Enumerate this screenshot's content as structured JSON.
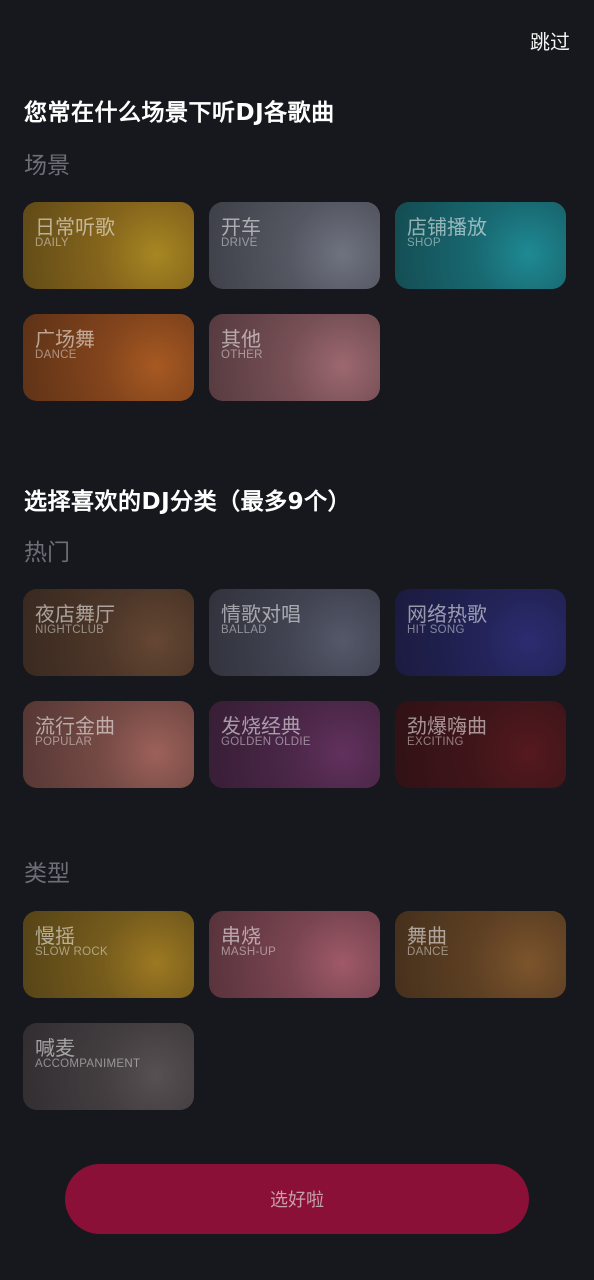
{
  "header": {
    "skip_label": "跳过"
  },
  "scene_section": {
    "title": "您常在什么场景下听DJ各歌曲",
    "group_label": "场景",
    "items": [
      {
        "name": "日常听歌",
        "en": "DAILY",
        "icon": "headphones-woman-photo",
        "color": "#c9961c"
      },
      {
        "name": "开车",
        "en": "DRIVE",
        "icon": "car-photo",
        "color": "#7a7f8c"
      },
      {
        "name": "店铺播放",
        "en": "SHOP",
        "icon": "building-photo",
        "color": "#1a9aa4"
      },
      {
        "name": "广场舞",
        "en": "DANCE",
        "icon": "cassette-photo",
        "color": "#c4601c"
      },
      {
        "name": "其他",
        "en": "OTHER",
        "icon": "pink-headphones-photo",
        "color": "#b07278"
      }
    ]
  },
  "category_section": {
    "title": "选择喜欢的DJ分类（最多9个）",
    "hot_label": "热门",
    "hot_items": [
      {
        "name": "夜店舞厅",
        "en": "NIGHTCLUB",
        "icon": "nightclub-silhouette-photo",
        "color": "#6e4a30"
      },
      {
        "name": "情歌对唱",
        "en": "BALLAD",
        "icon": "couple-sunset-photo",
        "color": "#5b5f72"
      },
      {
        "name": "网络热歌",
        "en": "HIT SONG",
        "icon": "neon-light-photo",
        "color": "#2a2a7a"
      },
      {
        "name": "流行金曲",
        "en": "POPULAR",
        "icon": "woman-headphones-photo",
        "color": "#b06a5e"
      },
      {
        "name": "发烧经典",
        "en": "GOLDEN OLDIE",
        "icon": "microphone-photo",
        "color": "#6a3062"
      },
      {
        "name": "劲爆嗨曲",
        "en": "EXCITING",
        "icon": "singer-red-photo",
        "color": "#5a1418"
      }
    ],
    "type_label": "类型",
    "type_items": [
      {
        "name": "慢摇",
        "en": "SLOW ROCK",
        "icon": "headphones-photo",
        "color": "#b0861c"
      },
      {
        "name": "串烧",
        "en": "MASH-UP",
        "icon": "vinyl-record-photo",
        "color": "#b46070"
      },
      {
        "name": "舞曲",
        "en": "DANCE",
        "icon": "dancers-photo",
        "color": "#8a5a28"
      },
      {
        "name": "喊麦",
        "en": "ACCOMPANIMENT",
        "icon": "studio-mic-photo",
        "color": "#5e5556"
      }
    ]
  },
  "footer": {
    "submit_label": "选好啦"
  }
}
